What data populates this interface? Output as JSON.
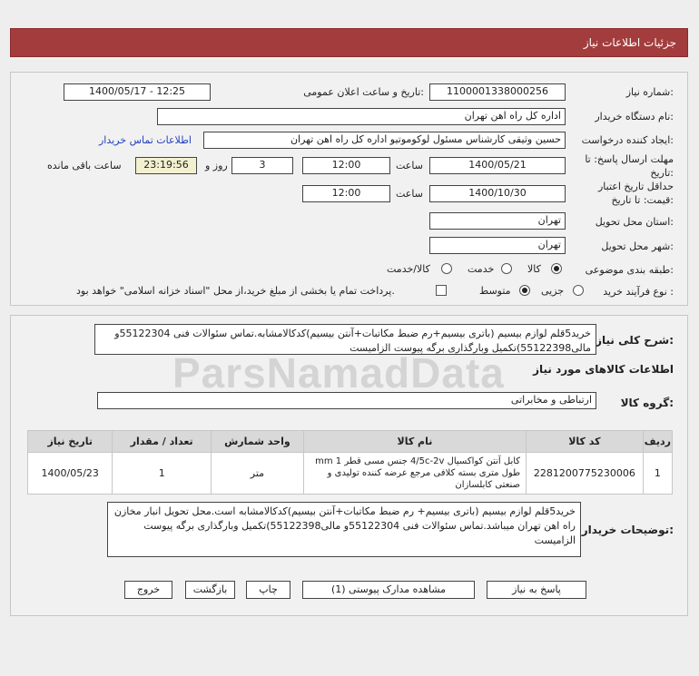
{
  "header": {
    "title": "جزئیات اطلاعات نیاز"
  },
  "watermark": "ParsNamadData",
  "form": {
    "need_number_label": "شماره نیاز:",
    "need_number": "1100001338000256",
    "announce_label": "تاریخ و ساعت اعلان عمومی:",
    "announce_value": "1400/05/17 - 12:25",
    "buyer_org_label": "نام دستگاه خریدار:",
    "buyer_org": "اداره کل راه اهن تهران",
    "requester_label": "ایجاد کننده درخواست:",
    "requester": "حسین وثیقی کارشناس مسئول لوکوموتیو اداره کل راه اهن تهران",
    "contact_link": "اطلاعات تماس خریدار",
    "deadline_label": "مهلت ارسال پاسخ: تا تاریخ:",
    "deadline_date": "1400/05/21",
    "time_label": "ساعت",
    "deadline_time": "12:00",
    "days": "3",
    "days_label": "روز و",
    "remaining_time": "23:19:56",
    "remaining_label": "ساعت باقی مانده",
    "validity_label": "حداقل تاریخ اعتبار قیمت: تا تاریخ:",
    "validity_date": "1400/10/30",
    "validity_time": "12:00",
    "province_label": "استان محل تحویل:",
    "province": "تهران",
    "city_label": "شهر محل تحویل:",
    "city": "تهران",
    "category_label": "طبقه بندی موضوعی:",
    "category_options": [
      "کالا",
      "خدمت",
      "کالا/خدمت"
    ],
    "process_label": "نوع فرآیند خرید :",
    "process_options": [
      "جزیی",
      "متوسط"
    ],
    "payment_note": "پرداخت تمام یا بخشی از مبلغ خرید،از محل \"اسناد خزانه اسلامی\" خواهد بود."
  },
  "details": {
    "summary_label": "شرح کلی نیاز:",
    "summary": "خرید5قلم لوازم بیسیم (باتری بیسیم+رم ضبط مکاتبات+آنتن بیسیم)کدکالامشابه.تماس سئوالات فنی 55122304و مالی55122398)تکمیل وبارگذاری برگه پیوست الزامیست",
    "goods_info_title": "اطلاعات کالاهای مورد نیاز",
    "goods_group_label": "گروه کالا:",
    "goods_group": "ارتباطی و مخابراتی",
    "table": {
      "headers": [
        "ردیف",
        "کد کالا",
        "نام کالا",
        "واحد شمارش",
        "تعداد / مقدار",
        "تاریخ نیاز"
      ],
      "rows": [
        {
          "row": "1",
          "code": "2281200775230006",
          "name": "کابل آنتن کواکسیال 4/5c-2v جنس مسی قطر 1 mm طول متری بسته کلافی مرجع عرضه کننده تولیدی و صنعتی کابلسازان",
          "unit": "متر",
          "qty": "1",
          "date": "1400/05/23"
        }
      ]
    },
    "buyer_notes_label": "توضیحات خریدار:",
    "buyer_notes": "خرید5قلم لوازم بیسیم (باتری بیسیم+ رم ضبط مکاتبات+آنتن بیسیم)کدکالامشابه است.محل تحویل انبار مخازن راه اهن تهران میباشد.تماس سئوالات فنی 55122304و مالی55122398)تکمیل وبارگذاری برگه پیوست الزامیست"
  },
  "buttons": {
    "reply": "پاسخ به نیاز",
    "attachments": "مشاهده مدارک پیوستی (1)",
    "print": "چاپ",
    "back": "بازگشت",
    "exit": "خروج"
  }
}
